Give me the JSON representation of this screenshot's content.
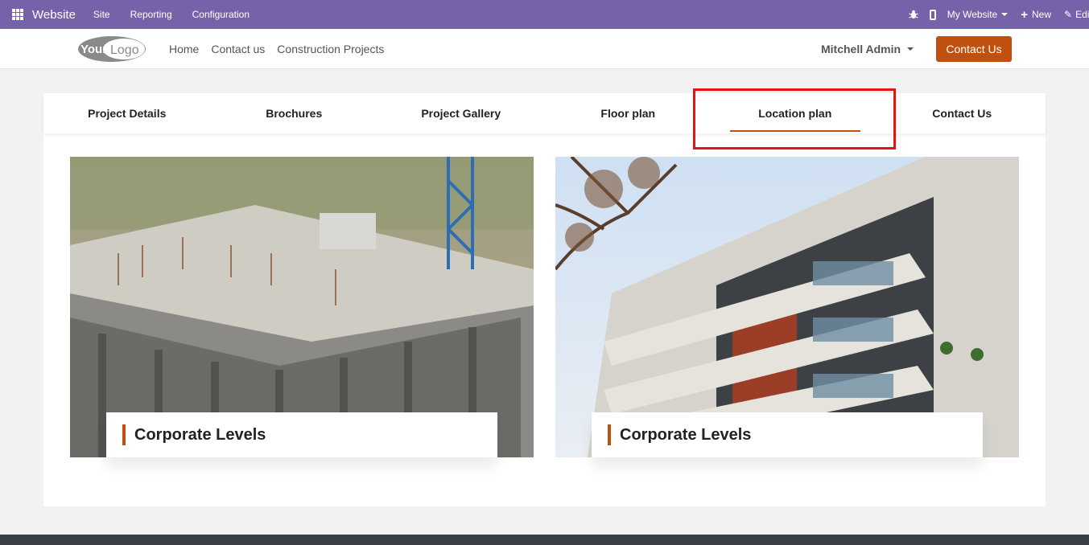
{
  "admin_bar": {
    "brand": "Website",
    "menu": [
      "Site",
      "Reporting",
      "Configuration"
    ],
    "my_website": "My Website",
    "new_label": "New",
    "edit_label": "Edit",
    "color": "#7562a8"
  },
  "navbar": {
    "logo_text": "YourLogo",
    "links": [
      "Home",
      "Contact us",
      "Construction Projects"
    ],
    "user": "Mitchell Admin",
    "contact_button": "Contact Us",
    "accent": "#c0500f"
  },
  "tabs": {
    "items": [
      "Project Details",
      "Brochures",
      "Project Gallery",
      "Floor plan",
      "Location plan",
      "Contact Us"
    ],
    "active": "Location plan"
  },
  "cards": [
    {
      "title": "Corporate Levels",
      "image": "construction-site-photo"
    },
    {
      "title": "Corporate Levels",
      "image": "modern-apartment-building-photo"
    }
  ]
}
